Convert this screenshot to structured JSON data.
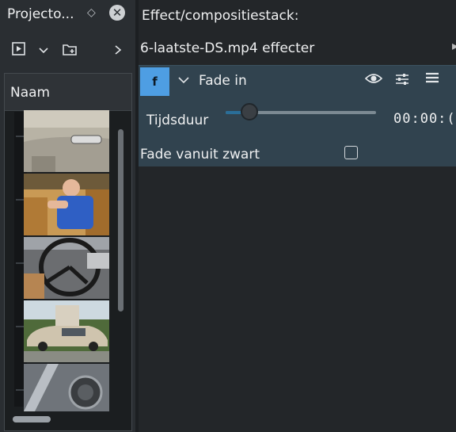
{
  "project_bin": {
    "title": "Projecto...",
    "float_icon": "diamond-icon",
    "close_icon": "close-icon",
    "toolbar": {
      "add_clip_icon": "add-clip-icon",
      "dropdown_icon": "chevron-down-icon",
      "add_folder_icon": "add-folder-icon",
      "more_icon": "chevron-right-icon"
    },
    "column_header": "Naam",
    "thumbnails": [
      "car-door-thumbnail",
      "child-in-car-thumbnail",
      "steering-wheel-thumbnail",
      "car-in-driveway-thumbnail",
      "headlight-thumbnail"
    ]
  },
  "effect_stack": {
    "title": "Effect/compositiestack:",
    "clip_label": "6-laatste-DS.mp4 effecter",
    "effect": {
      "badge": "f",
      "name": "Fade in",
      "colors": {
        "badge": "#4e9ee3",
        "panel": "#31434f"
      },
      "params": {
        "duration_label": "Tijdsduur",
        "duration_slider_fraction": 0.16,
        "duration_value": "00:00:(",
        "fade_from_black_label": "Fade vanuit zwart",
        "fade_from_black_checked": false
      }
    }
  }
}
